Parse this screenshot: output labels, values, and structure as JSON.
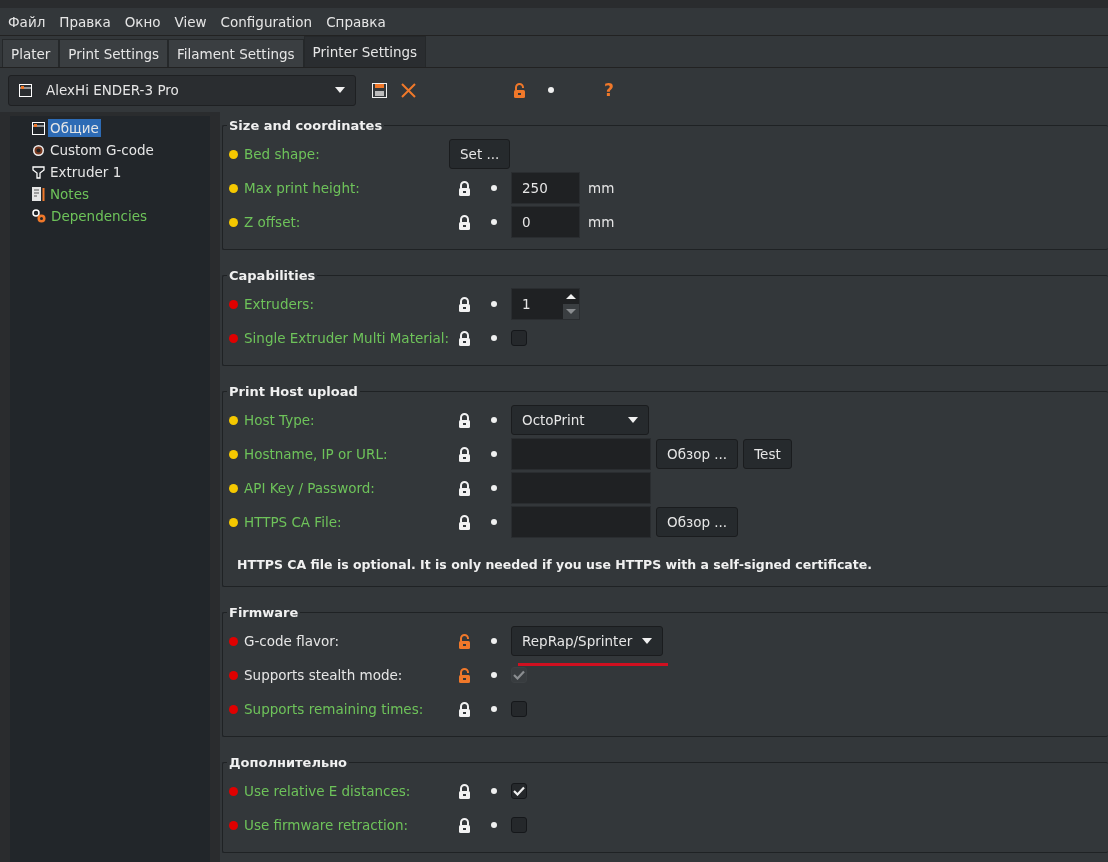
{
  "menu": [
    "Файл",
    "Правка",
    "Окно",
    "View",
    "Configuration",
    "Справка"
  ],
  "tabs": [
    {
      "label": "Plater",
      "selected": false
    },
    {
      "label": "Print Settings",
      "selected": false
    },
    {
      "label": "Filament Settings",
      "selected": false
    },
    {
      "label": "Printer Settings",
      "selected": true
    }
  ],
  "toolbar": {
    "preset": "AlexHi ENDER-3 Pro",
    "preset_locked": false,
    "help": "?"
  },
  "sidebar": {
    "items": [
      {
        "label": "Общие",
        "kind": "general",
        "system_value": false,
        "selected": true
      },
      {
        "label": "Custom G-code",
        "kind": "gcode",
        "system_value": false,
        "selected": false
      },
      {
        "label": "Extruder 1",
        "kind": "extruder",
        "system_value": false,
        "selected": false
      },
      {
        "label": "Notes",
        "kind": "notes",
        "system_value": true,
        "selected": false
      },
      {
        "label": "Dependencies",
        "kind": "dependencies",
        "system_value": true,
        "selected": false
      }
    ]
  },
  "sections": [
    {
      "title": "Size and coordinates",
      "rows": [
        {
          "label": "Bed shape:",
          "color": "#f5c800",
          "system_value": true,
          "kind": "button",
          "button": "Set ..."
        },
        {
          "label": "Max print height:",
          "color": "#f5c800",
          "system_value": true,
          "locked": true,
          "kind": "text",
          "value": "250",
          "unit": "mm"
        },
        {
          "label": "Z offset:",
          "color": "#f5c800",
          "system_value": true,
          "locked": true,
          "kind": "text",
          "value": "0",
          "unit": "mm"
        }
      ]
    },
    {
      "title": "Capabilities",
      "rows": [
        {
          "label": "Extruders:",
          "color": "#e00000",
          "system_value": true,
          "locked": true,
          "kind": "spin",
          "value": "1"
        },
        {
          "label": "Single Extruder Multi Material:",
          "color": "#e00000",
          "system_value": true,
          "locked": true,
          "kind": "checkbox",
          "checked": false,
          "disabled": false
        }
      ]
    },
    {
      "title": "Print Host upload",
      "rows": [
        {
          "label": "Host Type:",
          "color": "#f5c800",
          "system_value": true,
          "locked": true,
          "kind": "combo",
          "value": "OctoPrint"
        },
        {
          "label": "Hostname, IP or URL:",
          "color": "#f5c800",
          "system_value": true,
          "locked": true,
          "kind": "text",
          "buttons": [
            "Обзор ...",
            "Test"
          ]
        },
        {
          "label": "API Key / Password:",
          "color": "#f5c800",
          "system_value": true,
          "locked": true,
          "kind": "text"
        },
        {
          "label": "HTTPS CA File:",
          "color": "#f5c800",
          "system_value": true,
          "locked": true,
          "kind": "text",
          "buttons": [
            "Обзор ..."
          ]
        }
      ],
      "note": "HTTPS CA file is optional. It is only needed if you use HTTPS with a self-signed certificate."
    },
    {
      "title": "Firmware",
      "rows": [
        {
          "label": "G-code flavor:",
          "color": "#e00000",
          "system_value": false,
          "locked": false,
          "kind": "combo",
          "value": "RepRap/Sprinter",
          "underlined": true
        },
        {
          "label": "Supports stealth mode:",
          "color": "#e00000",
          "system_value": false,
          "locked": false,
          "kind": "checkbox",
          "checked": true,
          "disabled": true
        },
        {
          "label": "Supports remaining times:",
          "color": "#e00000",
          "system_value": true,
          "locked": true,
          "kind": "checkbox",
          "checked": false,
          "disabled": false
        }
      ]
    },
    {
      "title": "Дополнительно",
      "rows": [
        {
          "label": "Use relative E distances:",
          "color": "#e00000",
          "system_value": true,
          "locked": true,
          "kind": "checkbox",
          "checked": true,
          "disabled": false
        },
        {
          "label": "Use firmware retraction:",
          "color": "#e00000",
          "system_value": true,
          "locked": true,
          "kind": "checkbox",
          "checked": false,
          "disabled": false
        }
      ]
    }
  ]
}
